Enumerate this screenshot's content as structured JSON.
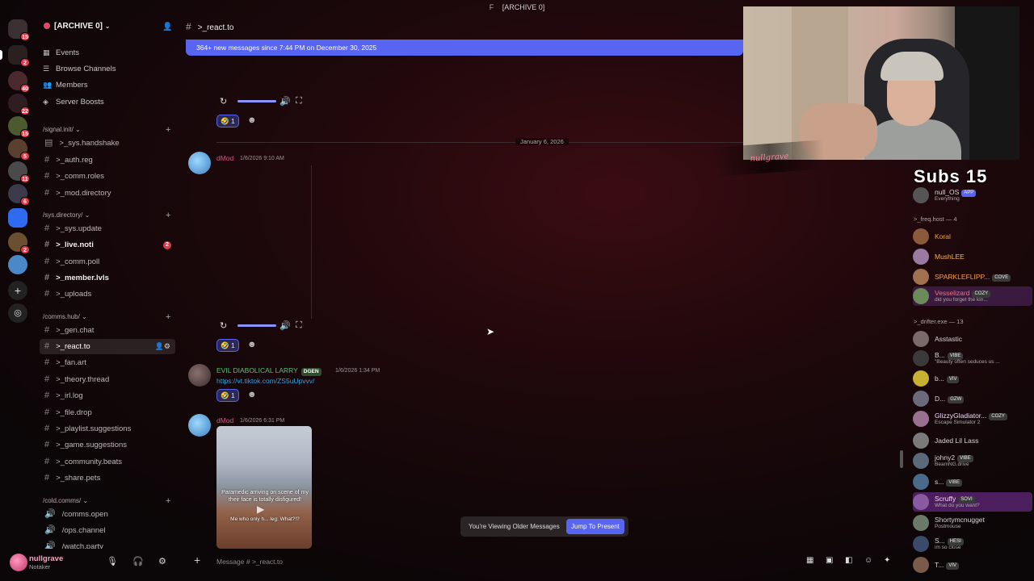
{
  "window": {
    "title_marker": "F",
    "title": "[ARCHIVE 0]"
  },
  "rail": {
    "badges": [
      "15",
      "2",
      "40",
      "22",
      "15",
      "5",
      "11",
      "6",
      "2"
    ]
  },
  "server": {
    "name": "[ARCHIVE 0]"
  },
  "nav": [
    {
      "icon": "calendar-icon",
      "label": "Events"
    },
    {
      "icon": "browse-icon",
      "label": "Browse Channels"
    },
    {
      "icon": "members-icon",
      "label": "Members"
    },
    {
      "icon": "boost-icon",
      "label": "Server Boosts"
    }
  ],
  "categories": [
    {
      "name": "/signal.init/"
    },
    {
      "name": "/sys.directory/"
    },
    {
      "name": "/comms.hub/"
    },
    {
      "name": "/cold.comms/"
    }
  ],
  "channels": {
    "signal": [
      ">_sys.handshake",
      ">_auth.reg",
      ">_comm.roles",
      ">_mod.directory"
    ],
    "sys": [
      ">_sys.update",
      ">_live.noti",
      ">_comm.poll",
      ">_member.lvls",
      ">_uploads"
    ],
    "comms": [
      ">_gen.chat",
      ">_react.to",
      ">_fan.art",
      ">_theory.thread",
      ">_irl.log",
      ">_file.drop",
      ">_playlist.suggestions",
      ">_game.suggestions",
      ">_community.beats",
      ">_share.pets"
    ],
    "cold": [
      "/comms.open",
      "/ops.channel",
      "/watch.party"
    ]
  },
  "live_noti_badge": "2",
  "user": {
    "name": "nullgrave",
    "status": "Notaker"
  },
  "chat": {
    "channel": ">_react.to",
    "banner": "364+ new messages since 7:44 PM on December 30, 2025",
    "date_divider": "January 6, 2026",
    "messages": [
      {
        "author": "dMod",
        "time": "1/6/2026 9:10 AM",
        "reaction": "1"
      },
      {
        "author": "EVIL DIABOLICAL LARRY",
        "tag": "DGEN",
        "time": "1/6/2026 1:34 PM",
        "link": "https://vt.tiktok.com/ZS5uUpvvv/",
        "reaction": "1"
      },
      {
        "author": "dMod",
        "time": "1/6/2026 6:31 PM",
        "caption": "Paramedic arriving on scene of my their face is totally disfigured!",
        "caption2": "Me who only h... leg: What?!?"
      }
    ],
    "first_reaction": "1",
    "older_notice": "You're Viewing Older Messages",
    "jump_label": "Jump To Present",
    "placeholder": "Message # >_react.to"
  },
  "stream_overlay": {
    "subs_label": "Subs 15",
    "signature": "nullgrave"
  },
  "members": {
    "app": {
      "name": "null_OS",
      "tag": "APP",
      "status": "Everything"
    },
    "groups": [
      {
        "header": ">_freq.host — 4"
      },
      {
        "header": ">_drifter.exe — 13"
      }
    ],
    "list": [
      {
        "name": "Koral",
        "color": "#f5a623"
      },
      {
        "name": "MushLEE",
        "color": "#ffb347"
      },
      {
        "name": "SPARKLEFLIPP...",
        "tag": "COVE",
        "color": "#ff9f43"
      },
      {
        "name": "Vesselizard",
        "tag": "COZY",
        "status": "did you forget the kin...",
        "color": "#ff6b81"
      },
      {
        "name": "Asstastic",
        "color": "#d8d4d6"
      },
      {
        "name": "B...",
        "tag": "VIBE",
        "status": "\"Beauty often seduces us ...",
        "color": "#d8d4d6"
      },
      {
        "name": "b...",
        "tag": "VIV",
        "color": "#d8d4d6"
      },
      {
        "name": "D...",
        "tag": "GZW",
        "color": "#d8d4d6"
      },
      {
        "name": "GlizzyGladiator...",
        "tag": "COZY",
        "status": "Escape Simulator 2",
        "color": "#f0d8ff"
      },
      {
        "name": "Jaded Lil Lass",
        "color": "#d8d4d6"
      },
      {
        "name": "johny2",
        "tag": "VIBE",
        "status": "BeamNG.drive",
        "color": "#d8d4d6"
      },
      {
        "name": "s...",
        "tag": "VIBE",
        "color": "#d8d4d6"
      },
      {
        "name": "Scruffy",
        "tag": "SOVI",
        "status": "What do you want?",
        "color": "#ffd6f0"
      },
      {
        "name": "Shortymcnugget",
        "status": "Postmouse",
        "color": "#d8d4d6"
      },
      {
        "name": "S...",
        "tag": "HESI",
        "status": "im so close",
        "color": "#d8d4d6"
      },
      {
        "name": "T...",
        "tag": "VIV",
        "color": "#d8d4d6"
      }
    ]
  }
}
